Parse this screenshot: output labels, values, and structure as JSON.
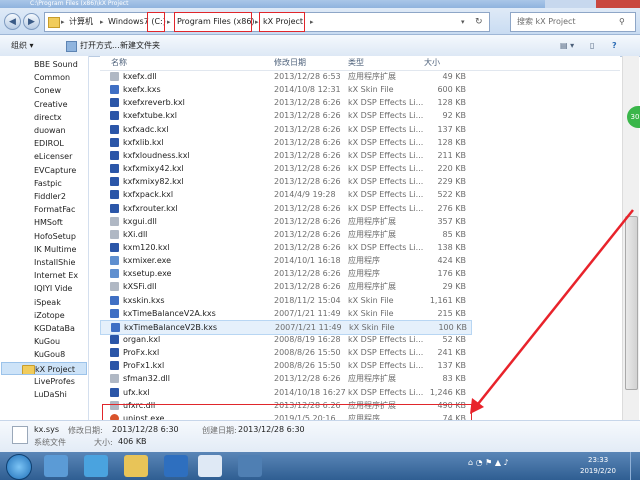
{
  "window": {
    "title_partial": "C:\\Program Files (x86)\\kX Project"
  },
  "address": {
    "crumbs": [
      "计算机",
      "Windows7 (C:)",
      "Program Files (x86)",
      "kX Project"
    ],
    "search_placeholder": "搜索 kX Project"
  },
  "toolbar": {
    "organize": "组织 ▾",
    "open_with": "打开方式...",
    "new_folder": "新建文件夹"
  },
  "nav": {
    "items": [
      "BBE Sound",
      "Common",
      "Conew",
      "Creative",
      "directx",
      "duowan",
      "EDIROL",
      "eLicenser",
      "EVCapture",
      "Fastpic",
      "Fiddler2",
      "FormatFac",
      "HMSoft",
      "HofoSetup",
      "IK Multime",
      "InstallShie",
      "Internet Ex",
      "IQIYI Vide",
      "iSpeak",
      "iZotope",
      "KGDataBa",
      "KuGou",
      "KuGou8",
      "kX Project",
      "LiveProfes",
      "LuDaShi"
    ]
  },
  "columns": {
    "name": "名称",
    "modified": "修改日期",
    "type": "类型",
    "size": "大小"
  },
  "files": [
    {
      "name": "kxefx.dll",
      "date": "2013/12/28 6:53",
      "type": "应用程序扩展",
      "size": "49 KB"
    },
    {
      "name": "kxefx.kxs",
      "date": "2014/10/8 12:31",
      "type": "kX Skin File",
      "size": "600 KB"
    },
    {
      "name": "kxefxreverb.kxl",
      "date": "2013/12/28 6:26",
      "type": "kX DSP Effects Li...",
      "size": "128 KB"
    },
    {
      "name": "kxefxtube.kxl",
      "date": "2013/12/28 6:26",
      "type": "kX DSP Effects Li...",
      "size": "92 KB"
    },
    {
      "name": "kxfxadc.kxl",
      "date": "2013/12/28 6:26",
      "type": "kX DSP Effects Li...",
      "size": "137 KB"
    },
    {
      "name": "kxfxlib.kxl",
      "date": "2013/12/28 6:26",
      "type": "kX DSP Effects Li...",
      "size": "128 KB"
    },
    {
      "name": "kxfxloudness.kxl",
      "date": "2013/12/28 6:26",
      "type": "kX DSP Effects Li...",
      "size": "211 KB"
    },
    {
      "name": "kxfxmixy42.kxl",
      "date": "2013/12/28 6:26",
      "type": "kX DSP Effects Li...",
      "size": "220 KB"
    },
    {
      "name": "kxfxmixy82.kxl",
      "date": "2013/12/28 6:26",
      "type": "kX DSP Effects Li...",
      "size": "229 KB"
    },
    {
      "name": "kxfxpack.kxl",
      "date": "2014/4/9 19:28",
      "type": "kX DSP Effects Li...",
      "size": "522 KB"
    },
    {
      "name": "kxfxrouter.kxl",
      "date": "2013/12/28 6:26",
      "type": "kX DSP Effects Li...",
      "size": "276 KB"
    },
    {
      "name": "kxgui.dll",
      "date": "2013/12/28 6:26",
      "type": "应用程序扩展",
      "size": "357 KB"
    },
    {
      "name": "kXi.dll",
      "date": "2013/12/28 6:26",
      "type": "应用程序扩展",
      "size": "85 KB"
    },
    {
      "name": "kxm120.kxl",
      "date": "2013/12/28 6:26",
      "type": "kX DSP Effects Li...",
      "size": "138 KB"
    },
    {
      "name": "kxmixer.exe",
      "date": "2014/10/1 16:18",
      "type": "应用程序",
      "size": "424 KB"
    },
    {
      "name": "kxsetup.exe",
      "date": "2013/12/28 6:26",
      "type": "应用程序",
      "size": "176 KB"
    },
    {
      "name": "kXSFi.dll",
      "date": "2013/12/28 6:26",
      "type": "应用程序扩展",
      "size": "29 KB"
    },
    {
      "name": "kxskin.kxs",
      "date": "2018/11/2 15:04",
      "type": "kX Skin File",
      "size": "1,161 KB"
    },
    {
      "name": "kxTimeBalanceV2A.kxs",
      "date": "2007/1/21 11:49",
      "type": "kX Skin File",
      "size": "215 KB"
    },
    {
      "name": "kxTimeBalanceV2B.kxs",
      "date": "2007/1/21 11:49",
      "type": "kX Skin File",
      "size": "100 KB"
    },
    {
      "name": "organ.kxl",
      "date": "2008/8/19 16:28",
      "type": "kX DSP Effects Li...",
      "size": "52 KB"
    },
    {
      "name": "ProFx.kxl",
      "date": "2008/8/26 15:50",
      "type": "kX DSP Effects Li...",
      "size": "241 KB"
    },
    {
      "name": "ProFx1.kxl",
      "date": "2008/8/26 15:50",
      "type": "kX DSP Effects Li...",
      "size": "137 KB"
    },
    {
      "name": "sfman32.dll",
      "date": "2013/12/28 6:26",
      "type": "应用程序扩展",
      "size": "83 KB"
    },
    {
      "name": "ufx.kxl",
      "date": "2014/10/18 16:27",
      "type": "kX DSP Effects Li...",
      "size": "1,246 KB"
    },
    {
      "name": "ufxrc.dll",
      "date": "2013/12/28 6:26",
      "type": "应用程序扩展",
      "size": "490 KB"
    },
    {
      "name": "uninst.exe",
      "date": "2019/1/5 20:16",
      "type": "应用程序",
      "size": "74 KB"
    }
  ],
  "details": {
    "filename": "kx.sys",
    "modified_label": "修改日期:",
    "modified_value": "2013/12/28 6:30",
    "created_label": "创建日期:",
    "created_value": "2013/12/28 6:30",
    "filetype": "系统文件",
    "size_label": "大小:",
    "size_value": "406 KB"
  },
  "badge": {
    "text": "30"
  },
  "tray": {
    "time": "23:33",
    "date": "2019/2/20"
  },
  "colors": {
    "highlight_red": "#e0262b",
    "arrow_red": "#e8232b",
    "taskbar": "#2f5e92"
  }
}
